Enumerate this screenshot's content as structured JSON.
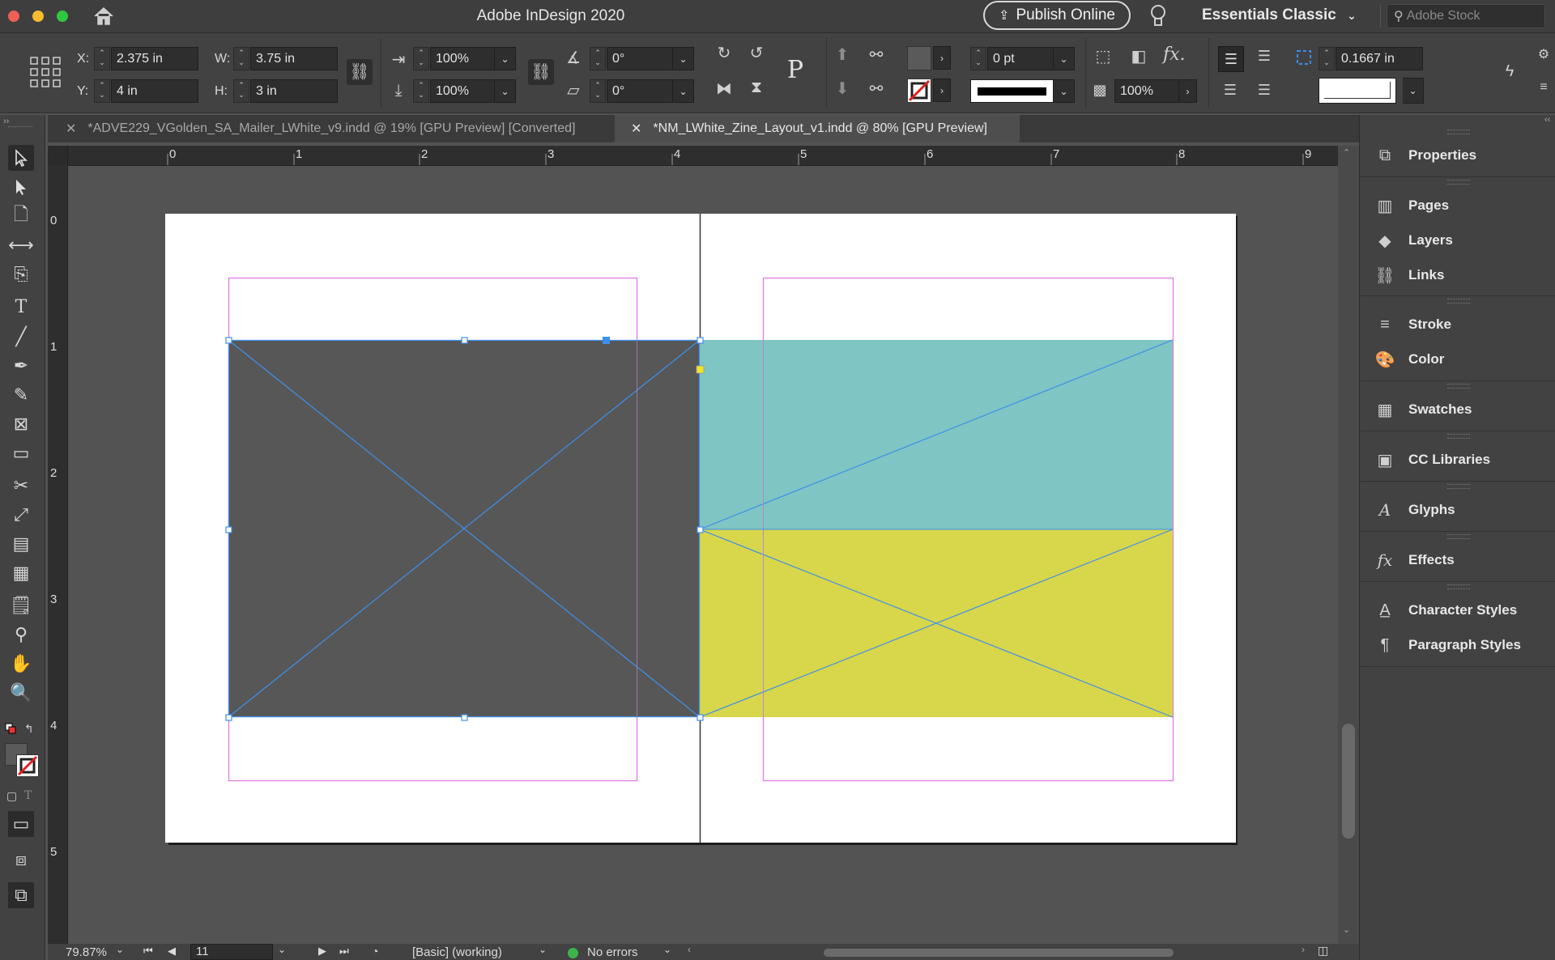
{
  "titlebar": {
    "app_title": "Adobe InDesign 2020",
    "publish_label": "Publish Online",
    "workspace": "Essentials Classic",
    "stock_placeholder": "Adobe Stock"
  },
  "control": {
    "x_label": "X:",
    "x_value": "2.375 in",
    "y_label": "Y:",
    "y_value": "4 in",
    "w_label": "W:",
    "w_value": "3.75 in",
    "h_label": "H:",
    "h_value": "3 in",
    "scale_x": "100%",
    "scale_y": "100%",
    "rotate": "0°",
    "shear": "0°",
    "stroke_weight": "0 pt",
    "opacity": "100%",
    "offset": "0.1667 in"
  },
  "tabs": [
    {
      "label": "*ADVE229_VGolden_SA_Mailer_LWhite_v9.indd @ 19% [GPU Preview] [Converted]",
      "active": false
    },
    {
      "label": "*NM_LWhite_Zine_Layout_v1.indd @ 80% [GPU Preview]",
      "active": true
    }
  ],
  "ruler": {
    "h_ticks": [
      "0",
      "1",
      "2",
      "3",
      "4",
      "5",
      "6",
      "7",
      "8",
      "9"
    ],
    "v_ticks": [
      "0",
      "1",
      "2",
      "3",
      "4",
      "5"
    ]
  },
  "panels": [
    {
      "label": "Properties",
      "icon": "properties-icon"
    },
    {
      "label": "Pages",
      "icon": "pages-icon"
    },
    {
      "label": "Layers",
      "icon": "layers-icon"
    },
    {
      "label": "Links",
      "icon": "links-icon"
    },
    {
      "label": "Stroke",
      "icon": "stroke-icon"
    },
    {
      "label": "Color",
      "icon": "color-icon"
    },
    {
      "label": "Swatches",
      "icon": "swatches-icon"
    },
    {
      "label": "CC Libraries",
      "icon": "cc-libraries-icon"
    },
    {
      "label": "Glyphs",
      "icon": "glyphs-icon"
    },
    {
      "label": "Effects",
      "icon": "effects-icon"
    },
    {
      "label": "Character Styles",
      "icon": "character-styles-icon"
    },
    {
      "label": "Paragraph Styles",
      "icon": "paragraph-styles-icon"
    }
  ],
  "status": {
    "zoom": "79.87%",
    "page": "11",
    "profile": "[Basic] (working)",
    "preflight": "No errors"
  },
  "colors": {
    "teal_frame": "#7fc5c4",
    "yellow_frame": "#d8d64b",
    "gray_frame": "#575757",
    "margin_guide": "#e27ae6",
    "selection": "#3f8fe8"
  }
}
